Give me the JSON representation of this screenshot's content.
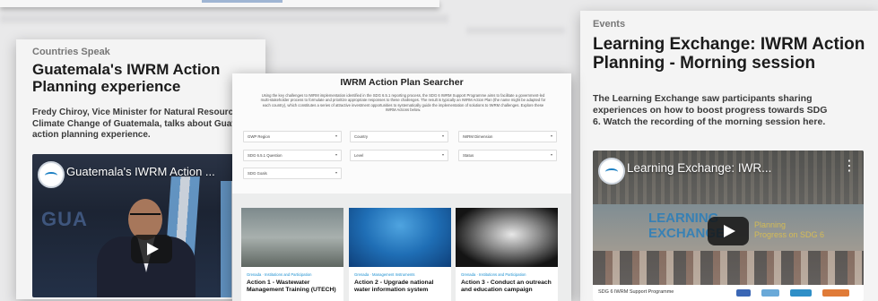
{
  "left_card": {
    "category": "Countries Speak",
    "title": "Guatemala's IWRM Action Planning experience",
    "description_lines": [
      "Fredy Chiroy, Vice Minister for Natural Resource",
      "Climate Change of Guatemala, talks about Guate",
      "action planning experience."
    ],
    "video": {
      "title": "Guatemala's IWRM Action ...",
      "bg_text": "GUA"
    }
  },
  "searcher": {
    "title": "IWRM Action Plan Searcher",
    "intro": "Using the key challenges to IWRM implementation identified in the SDG 6.5.1 reporting process, the SDG 6 IWRM Support Programme aims to facilitate a government-led multi-stakeholder process to formulate and prioritize appropriate responses to these challenges. The result is typically an IWRM Action Plan (the name might be adapted for each country), which constitutes a series of attractive investment opportunities to systematically guide the implementation of solutions to IWRM challenges. Explore these IWRM Actions below.",
    "filters": [
      "GWP Region",
      "Country",
      "IWRM Dimension",
      "SDG 6.5.1 Question",
      "Level",
      "Status",
      "SDG Goals"
    ],
    "results": [
      {
        "category": "Grenada · Institutions and Participation",
        "title": "Action 1 - Wastewater Management Training (UTECH)"
      },
      {
        "category": "Grenada · Management Instruments",
        "title": "Action 2 - Upgrade national water information system"
      },
      {
        "category": "Grenada · Institutions and Participation",
        "title": "Action 3 - Conduct an outreach and education campaign"
      }
    ]
  },
  "right_card": {
    "category": "Events",
    "title_lines": [
      "Learning Exchange: IWRM Action",
      "Planning - Morning session"
    ],
    "description_lines": [
      "The Learning Exchange  saw participants sharing",
      "experiences on how to boost progress towards SDG",
      "6. Watch the recording of the morning session here."
    ],
    "video": {
      "title": "Learning Exchange: IWR...",
      "banner_lines": [
        "LEARNING",
        "EXCHANGE"
      ],
      "banner_sub_lines": [
        "Planning",
        "Progress on SDG 6"
      ],
      "programme": "SDG 6 IWRM Support Programme"
    }
  },
  "colors": {
    "link_blue": "#1a8fd0",
    "card_bg": "#f4f4f4",
    "page_bg": "#e9e9ea"
  }
}
